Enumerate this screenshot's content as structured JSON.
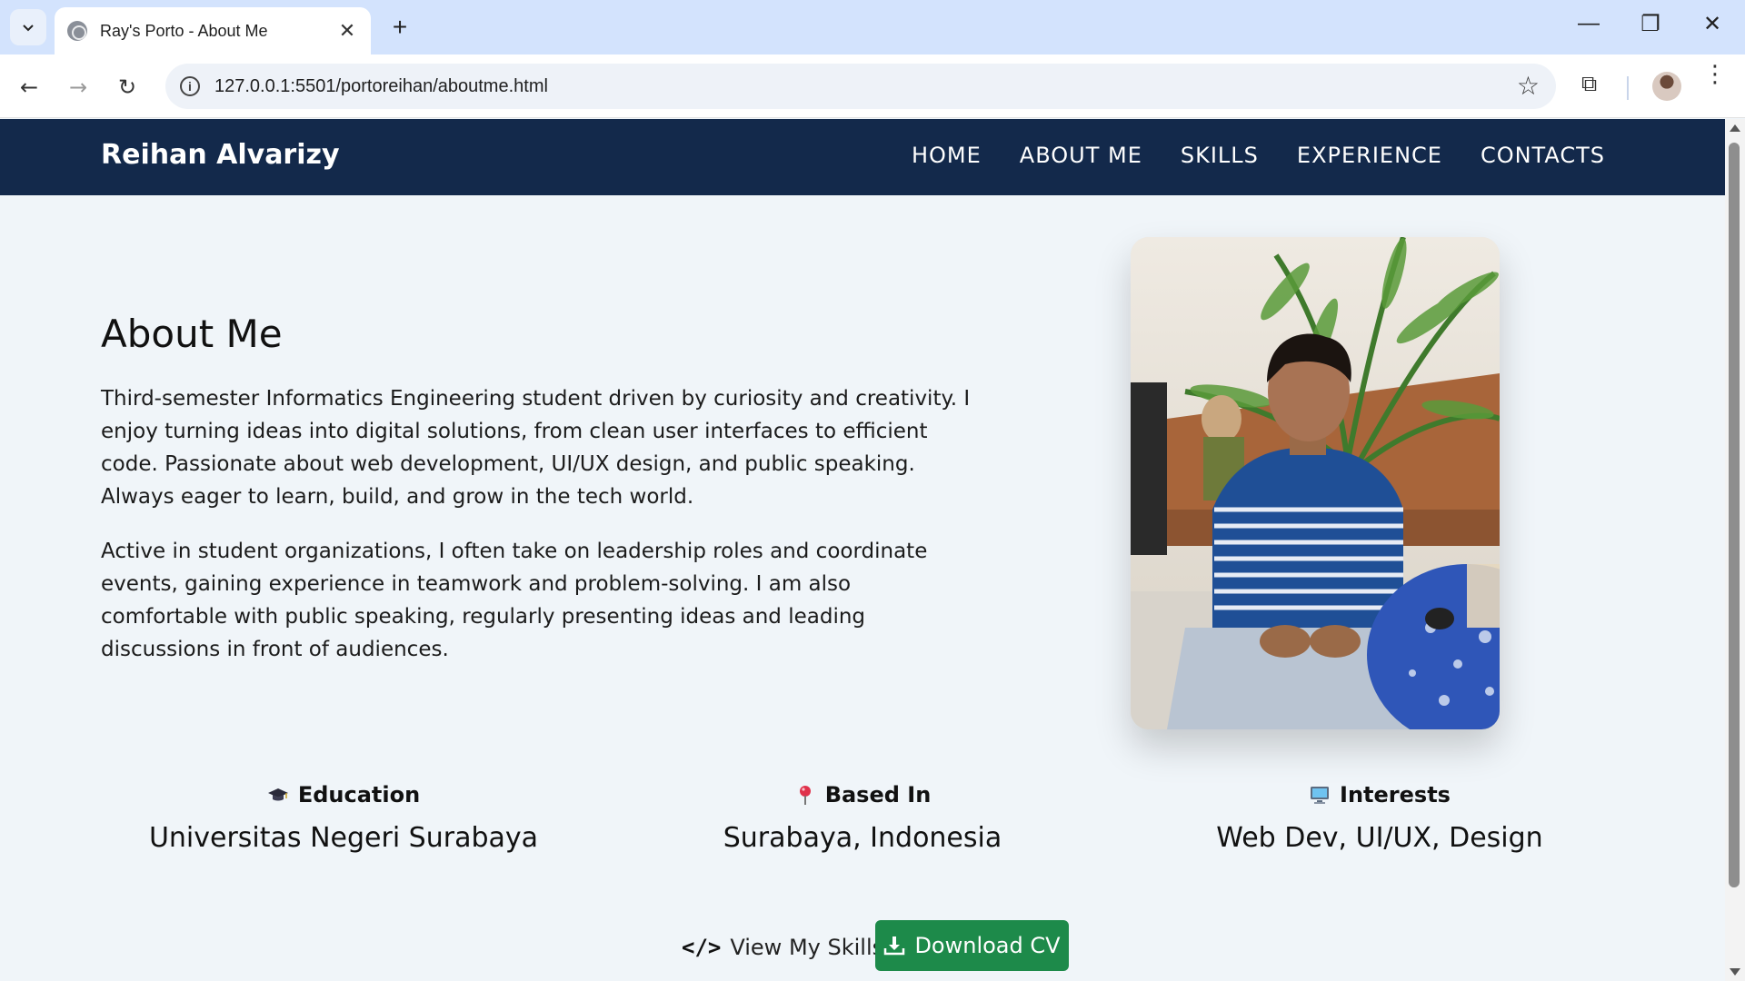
{
  "browser": {
    "tab_title": "Ray's Porto - About Me",
    "url": "127.0.0.1:5501/portoreihan/aboutme.html"
  },
  "site": {
    "brand": "Reihan Alvarizy",
    "nav": [
      "HOME",
      "ABOUT ME",
      "SKILLS",
      "EXPERIENCE",
      "CONTACTS"
    ]
  },
  "about": {
    "title": "About Me",
    "paragraphs": [
      "Third-semester Informatics Engineering student driven by curiosity and creativity. I enjoy turning ideas into digital solutions, from clean user interfaces to efficient code. Passionate about web development, UI/UX design, and public speaking. Always eager to learn, build, and grow in the tech world.",
      "Active in student organizations, I often take on leadership roles and coordinate events, gaining experience in teamwork and problem-solving. I am also comfortable with public speaking, regularly presenting ideas and leading discussions in front of audiences."
    ]
  },
  "facts": [
    {
      "icon": "graduation-cap-icon",
      "label": "Education",
      "value": "Universitas Negeri Surabaya"
    },
    {
      "icon": "map-pin-icon",
      "label": "Based In",
      "value": "Surabaya, Indonesia"
    },
    {
      "icon": "computer-icon",
      "label": "Interests",
      "value": "Web Dev, UI/UX, Design"
    }
  ],
  "buttons": {
    "skills": "View My Skills",
    "cv": "Download CV"
  },
  "colors": {
    "nav_bg": "#13294b",
    "page_bg": "#f0f5f9",
    "cv_button": "#1d8a4a"
  }
}
